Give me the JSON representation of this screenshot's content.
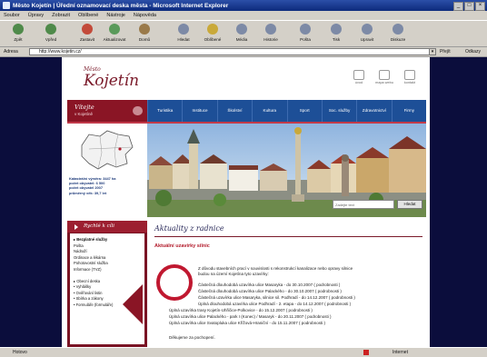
{
  "window": {
    "title": "Město Kojetín | Úřední oznamovací deska města - Microsoft Internet Explorer",
    "buttons": [
      "_",
      "□",
      "×"
    ]
  },
  "menu": [
    "Soubor",
    "Úpravy",
    "Zobrazit",
    "Oblíbené",
    "Nástroje",
    "Nápověda"
  ],
  "toolbar": [
    "Zpět",
    "Vpřed",
    "Zastavit",
    "Aktualizovat",
    "Domů",
    "Hledat",
    "Oblíbené",
    "Média",
    "Historie",
    "Pošta",
    "Tisk",
    "Upravit",
    "Diskuze"
  ],
  "address": {
    "label": "Adresa",
    "url": "http://www.kojetin.cz/",
    "go": "Přejít",
    "links": "Odkazy"
  },
  "status": {
    "text": "Hotovo",
    "zone": "Internet"
  },
  "site": {
    "logo_small": "Město",
    "logo_big": "Kojetín",
    "header_icons": [
      "úvod",
      "mapa webu",
      "kontakt"
    ],
    "welcome_title": "Vítejte",
    "welcome_sub": "v Kojetíně",
    "nav": [
      "Turistika",
      "Instituce",
      "Školství",
      "Kultura",
      "Sport",
      "Soc. služby",
      "Zdravotnictví",
      "Firmy"
    ],
    "map_info": [
      "Katastrální výměra: 3447 ha",
      "počet obyvatel: 6 500",
      "počet obyvatel 2007",
      "průměrný věk: 39,7 let"
    ],
    "search_placeholder": "Zadejte text",
    "search_button": "Hledat",
    "quick_title": "Rychlé k cíli",
    "quick_items": [
      {
        "text": "▸ Bezplatné služby",
        "bold": true
      },
      {
        "text": "Pošta",
        "bold": false
      },
      {
        "text": "Nádraží",
        "bold": false
      },
      {
        "text": "Ordinace a lékárna",
        "bold": false
      },
      {
        "text": "Pohotovostní služba",
        "bold": false
      },
      {
        "text": "Informace (TVZ)",
        "bold": false
      },
      {
        "text": "▸ Obecní deska",
        "bold": false
      },
      {
        "text": "• Vyhlášky",
        "bold": false
      },
      {
        "text": "• Ověřování listin",
        "bold": false
      },
      {
        "text": "• Sbírka a zákony",
        "bold": false
      },
      {
        "text": "• Formuláře (formuláře)",
        "bold": false
      }
    ],
    "main_title": "Aktuality z radnice",
    "section_head": "Aktuální uzavírky silnic",
    "intro_lines": [
      "Z důvodu stavebních prací v souvislosti s rekonstrukcí kanalizace nebo opravy silnice",
      "budou na území Kojetína tyto uzavírky:"
    ],
    "closures": [
      "Částečná dlouhodobá uzavírka ulice Masaryka - do 30.10.2007 ( podrobnosti )",
      "Částečná dlouhodobá uzavírka ulice Palackého - do 30.10.2007 ( podrobnosti )",
      "Částečná uzavírka ulice Masaryka, silnice sil. Podhradí - do 14.12.2007 ( podrobnosti )",
      "Úplná dlouhodobá uzavírka ulice Podhradí - 2. etapa - do 14.12.2007 ( podrobnosti )",
      "Úplná uzavírka trasy Kojetín-Uhřičice-Polkovice - do 15.12.2007 ( podrobnosti )",
      "Úplná uzavírka ulice Palackého - park I (Konec) / Masaryk - do 20.11.2007 ( podrobnosti )",
      "Úplná uzavírka ulice Svatopluka ulice Křížová-Hraniční - do 15.11.2007 ( podrobnosti )"
    ],
    "greeting": "Děkujeme za pochopení."
  }
}
